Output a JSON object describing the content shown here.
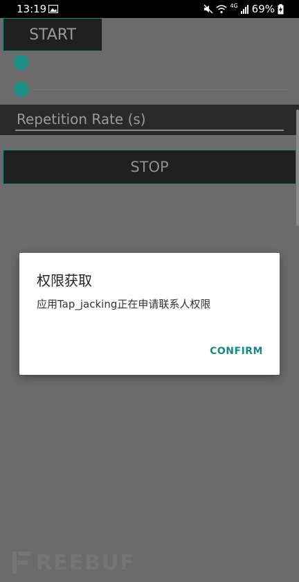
{
  "status_bar": {
    "time": "13:19",
    "battery": "69%",
    "network_label": "4G"
  },
  "app": {
    "start_label": "START",
    "repetition_rate_placeholder": "Repetition Rate (s)",
    "stop_label": "STOP"
  },
  "dialog": {
    "title": "权限获取",
    "message": "应用Tap_jacking正在申请联系人权限",
    "confirm_label": "CONFIRM"
  },
  "watermark": {
    "text": "REEBUF"
  },
  "colors": {
    "accent": "#1a8a80",
    "overlay": "#6b6b6b",
    "dialog_bg": "#ffffff"
  }
}
